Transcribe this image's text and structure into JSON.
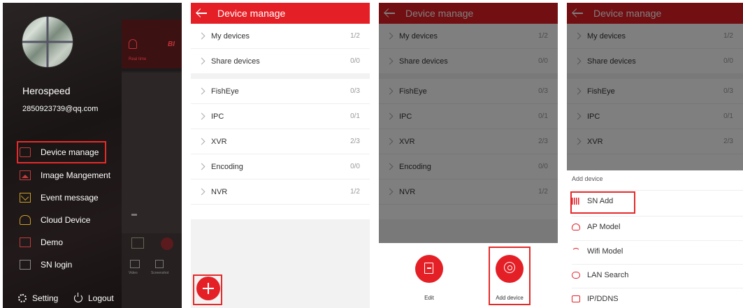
{
  "colors": {
    "accent": "#e41f26",
    "highlight_box": "#e52a2a",
    "menu_bg": "#1b1717"
  },
  "panel1": {
    "user_name": "Herospeed",
    "user_email": "2850923739@qq.com",
    "menu": [
      {
        "label": "Device manage",
        "icon": "camera-icon"
      },
      {
        "label": "Image Mangement",
        "icon": "image-icon"
      },
      {
        "label": "Event message",
        "icon": "mail-icon"
      },
      {
        "label": "Cloud Device",
        "icon": "cloud-icon"
      },
      {
        "label": "Demo",
        "icon": "demo-icon"
      },
      {
        "label": "SN login",
        "icon": "sn-icon"
      }
    ],
    "bottom": {
      "setting": "Setting",
      "logout": "Logout"
    },
    "background_app": {
      "brand_fragment": "BI",
      "tab_label": "Real time",
      "video_label": "Video",
      "screenshot_label": "Screenshot"
    }
  },
  "device_manage": {
    "title": "Device manage",
    "rows": [
      {
        "name": "My devices",
        "count": "1/2"
      },
      {
        "name": "Share devices",
        "count": "0/0"
      },
      {
        "name": "FishEye",
        "count": "0/3"
      },
      {
        "name": "IPC",
        "count": "0/1"
      },
      {
        "name": "XVR",
        "count": "2/3"
      },
      {
        "name": "Encoding",
        "count": "0/0"
      },
      {
        "name": "NVR",
        "count": "1/2"
      }
    ]
  },
  "panel3": {
    "edit_label": "Edit",
    "add_device_label": "Add device"
  },
  "panel4": {
    "sheet_title": "Add device",
    "options": [
      {
        "label": "SN Add",
        "icon": "barcode-icon"
      },
      {
        "label": "AP Model",
        "icon": "ap-icon"
      },
      {
        "label": "Wifi Model",
        "icon": "wifi-icon"
      },
      {
        "label": "LAN Search",
        "icon": "location-icon"
      },
      {
        "label": "IP/DDNS",
        "icon": "ip-icon"
      }
    ]
  }
}
